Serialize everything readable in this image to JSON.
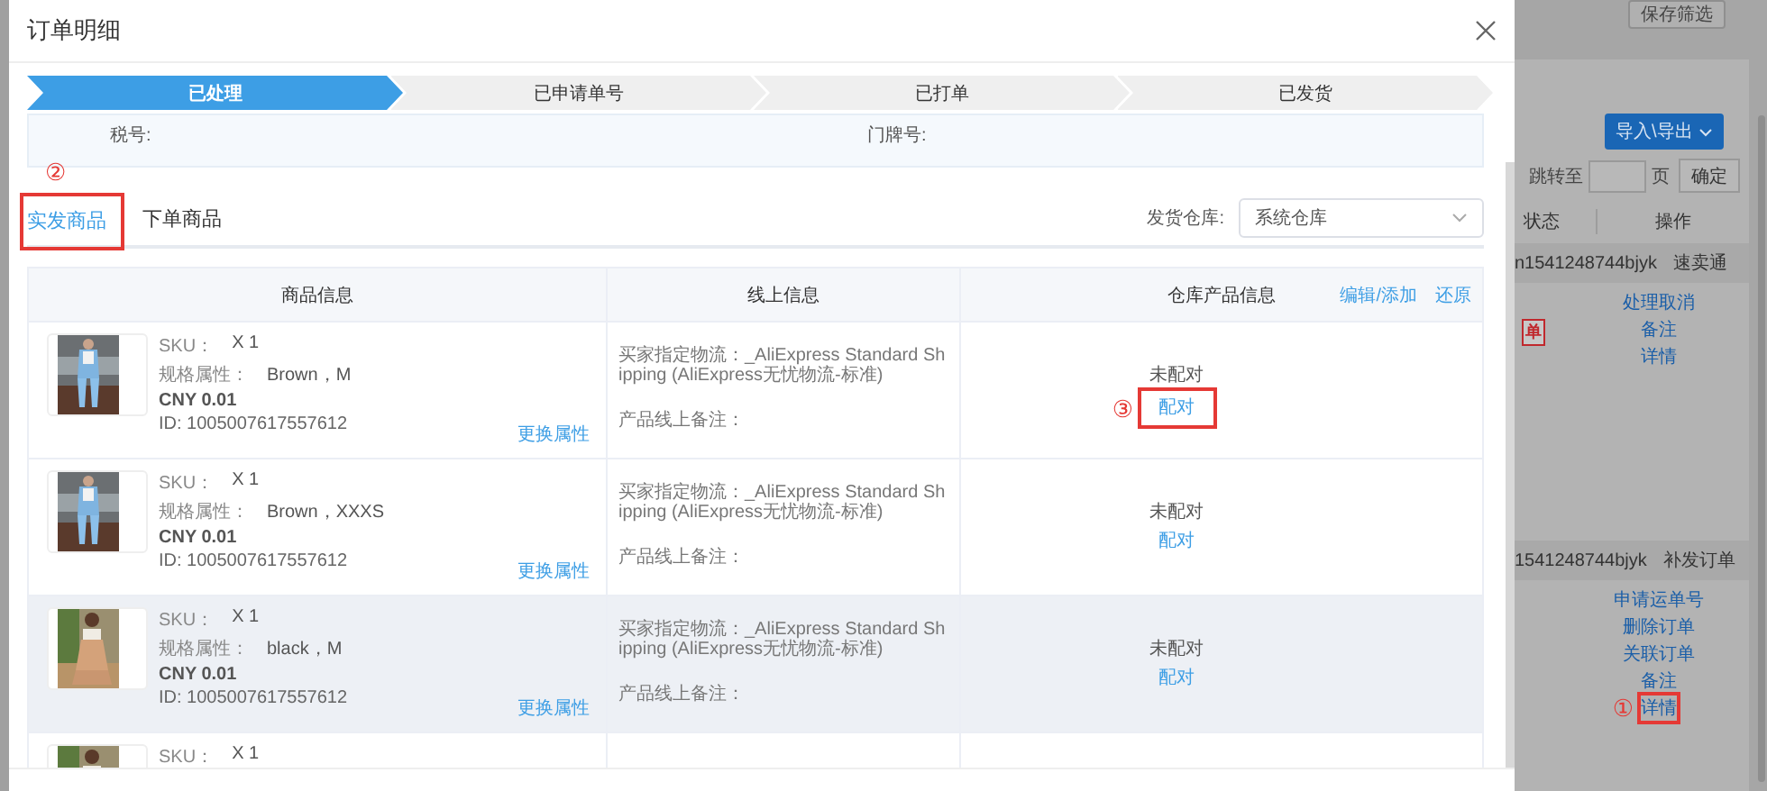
{
  "dialog": {
    "title": "订单明细"
  },
  "steps": [
    {
      "label": "已处理",
      "selected": true
    },
    {
      "label": "已申请单号",
      "selected": false
    },
    {
      "label": "已打单",
      "selected": false
    },
    {
      "label": "已发货",
      "selected": false
    }
  ],
  "info": {
    "fields": [
      {
        "label": "税号:"
      },
      {
        "label": "门牌号:"
      }
    ]
  },
  "tabs": [
    {
      "label": "实发商品",
      "selected": true,
      "annotation": "②"
    },
    {
      "label": "下单商品",
      "selected": false
    }
  ],
  "warehouse": {
    "label": "发货仓库:",
    "value": "系统仓库"
  },
  "table": {
    "columns": [
      "商品信息",
      "线上信息",
      "仓库产品信息"
    ],
    "header_links": [
      "编辑/添加",
      "还原"
    ],
    "rows": [
      {
        "highlighted": false,
        "sku_label": "SKU：",
        "quantity": "X 1",
        "spec_label": "规格属性：",
        "spec": "Brown，M",
        "price": "CNY 0.01",
        "id": "ID: 1005007617557612",
        "change_link": "更换属性",
        "shipping": "买家指定物流：_AliExpress Standard Shipping (AliExpress无忧物流-标准)",
        "remark": "产品线上备注：",
        "match_status": "未配对",
        "match_link": "配对",
        "match_annotation": "③"
      },
      {
        "highlighted": false,
        "sku_label": "SKU：",
        "quantity": "X 1",
        "spec_label": "规格属性：",
        "spec": "Brown，XXXS",
        "price": "CNY 0.01",
        "id": "ID: 1005007617557612",
        "change_link": "更换属性",
        "shipping": "买家指定物流：_AliExpress Standard Shipping (AliExpress无忧物流-标准)",
        "remark": "产品线上备注：",
        "match_status": "未配对",
        "match_link": "配对"
      },
      {
        "highlighted": true,
        "sku_label": "SKU：",
        "quantity": "X 1",
        "spec_label": "规格属性：",
        "spec": "black，M",
        "price": "CNY 0.01",
        "id": "ID: 1005007617557612",
        "change_link": "更换属性",
        "shipping": "买家指定物流：_AliExpress Standard Shipping (AliExpress无忧物流-标准)",
        "remark": "产品线上备注：",
        "match_status": "未配对",
        "match_link": "配对"
      },
      {
        "highlighted": false,
        "sku_label": "SKU：",
        "quantity": "X 1"
      }
    ]
  },
  "background": {
    "save_filter": "保存筛选",
    "import_export": "导入\\导出",
    "jump_label": "跳转至",
    "page_unit": "页",
    "confirm": "确定",
    "columns": [
      "状态",
      "操作"
    ],
    "orders": [
      {
        "number": "n1541248744bjyk",
        "platform": "速卖通",
        "badge": "单",
        "actions": [
          {
            "label": "处理取消"
          },
          {
            "label": "备注"
          },
          {
            "label": "详情"
          }
        ]
      },
      {
        "number": "1541248744bjyk",
        "platform": "补发订单",
        "actions": [
          {
            "label": "申请运单号"
          },
          {
            "label": "删除订单"
          },
          {
            "label": "关联订单"
          },
          {
            "label": "备注"
          },
          {
            "label": "详情",
            "annotation": "①"
          }
        ]
      }
    ]
  }
}
